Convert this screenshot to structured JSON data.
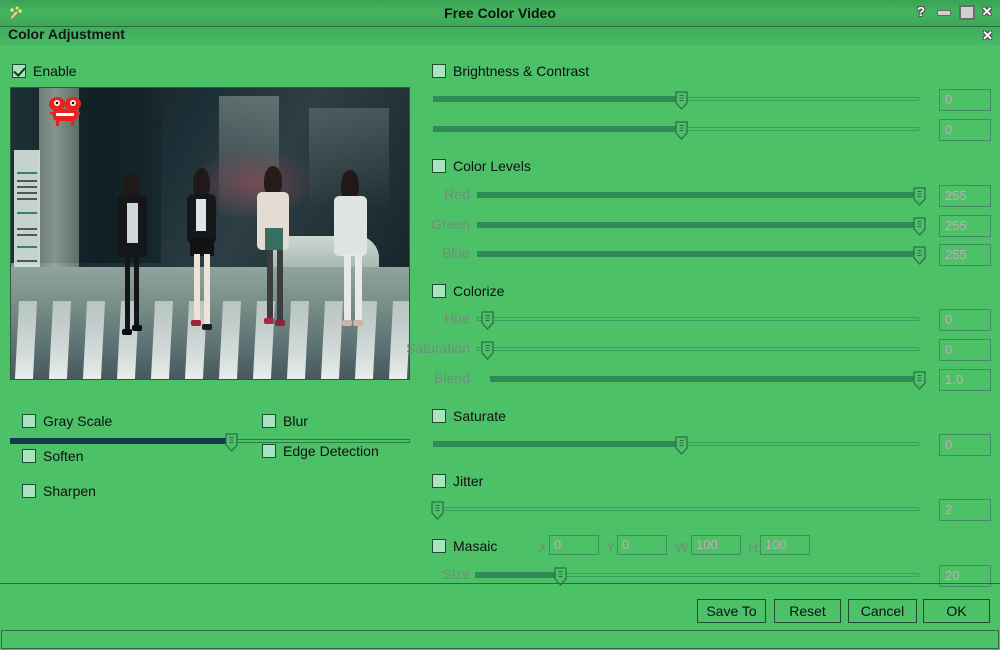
{
  "window": {
    "title": "Free Color Video",
    "icon": "app-icon",
    "help_glyph": "?",
    "minimize_glyph": "",
    "maximize_glyph": "",
    "close_glyph": "✕"
  },
  "dialog": {
    "title": "Color Adjustment",
    "close_glyph": "✕"
  },
  "enable": {
    "label": "Enable",
    "checked": true
  },
  "preview": {
    "position_value": 55
  },
  "filters": [
    {
      "label": "Gray Scale",
      "checked": false
    },
    {
      "label": "Soften",
      "checked": false
    },
    {
      "label": "Sharpen",
      "checked": false
    },
    {
      "label": "Blur",
      "checked": false
    },
    {
      "label": "Edge Detection",
      "checked": false
    }
  ],
  "brightness_contrast": {
    "label": "Brightness & Contrast",
    "checked": false,
    "sliders": [
      {
        "name": "brightness",
        "value": "0",
        "percent": 51
      },
      {
        "name": "contrast",
        "value": "0",
        "percent": 51
      }
    ]
  },
  "color_levels": {
    "label": "Color Levels",
    "checked": false,
    "sliders": [
      {
        "name": "Red",
        "value": "255",
        "percent": 100
      },
      {
        "name": "Green",
        "value": "255",
        "percent": 100
      },
      {
        "name": "Blue",
        "value": "255",
        "percent": 100
      }
    ]
  },
  "colorize": {
    "label": "Colorize",
    "checked": false,
    "sliders": [
      {
        "name": "Hue",
        "value": "0",
        "percent": 0
      },
      {
        "name": "Saturation",
        "value": "0",
        "percent": 0
      },
      {
        "name": "Blend",
        "value": "1.0",
        "percent": 100
      }
    ]
  },
  "saturate": {
    "label": "Saturate",
    "checked": false,
    "sliders": [
      {
        "name": "saturate",
        "value": "0",
        "percent": 51
      }
    ]
  },
  "jitter": {
    "label": "Jitter",
    "checked": false,
    "sliders": [
      {
        "name": "jitter",
        "value": "2",
        "percent": 0
      }
    ]
  },
  "masaic": {
    "label": "Masaic",
    "checked": false,
    "fields": [
      {
        "label": "X",
        "value": "0"
      },
      {
        "label": "Y",
        "value": "0"
      },
      {
        "label": "W",
        "value": "100"
      },
      {
        "label": "H",
        "value": "100"
      }
    ],
    "size": {
      "name": "Size",
      "value": "20",
      "percent": 19
    }
  },
  "buttons": {
    "save_to": "Save To",
    "reset": "Reset",
    "cancel": "Cancel",
    "ok": "OK"
  },
  "colors": {
    "window_bg": "#4cc168",
    "title_grad_top": "#3aa255",
    "slider_fill": "#2f8a56",
    "value_text": "#cfa6bc",
    "label_text": "#6f8f7c",
    "checkbox_bg": "#a9e3bf"
  }
}
